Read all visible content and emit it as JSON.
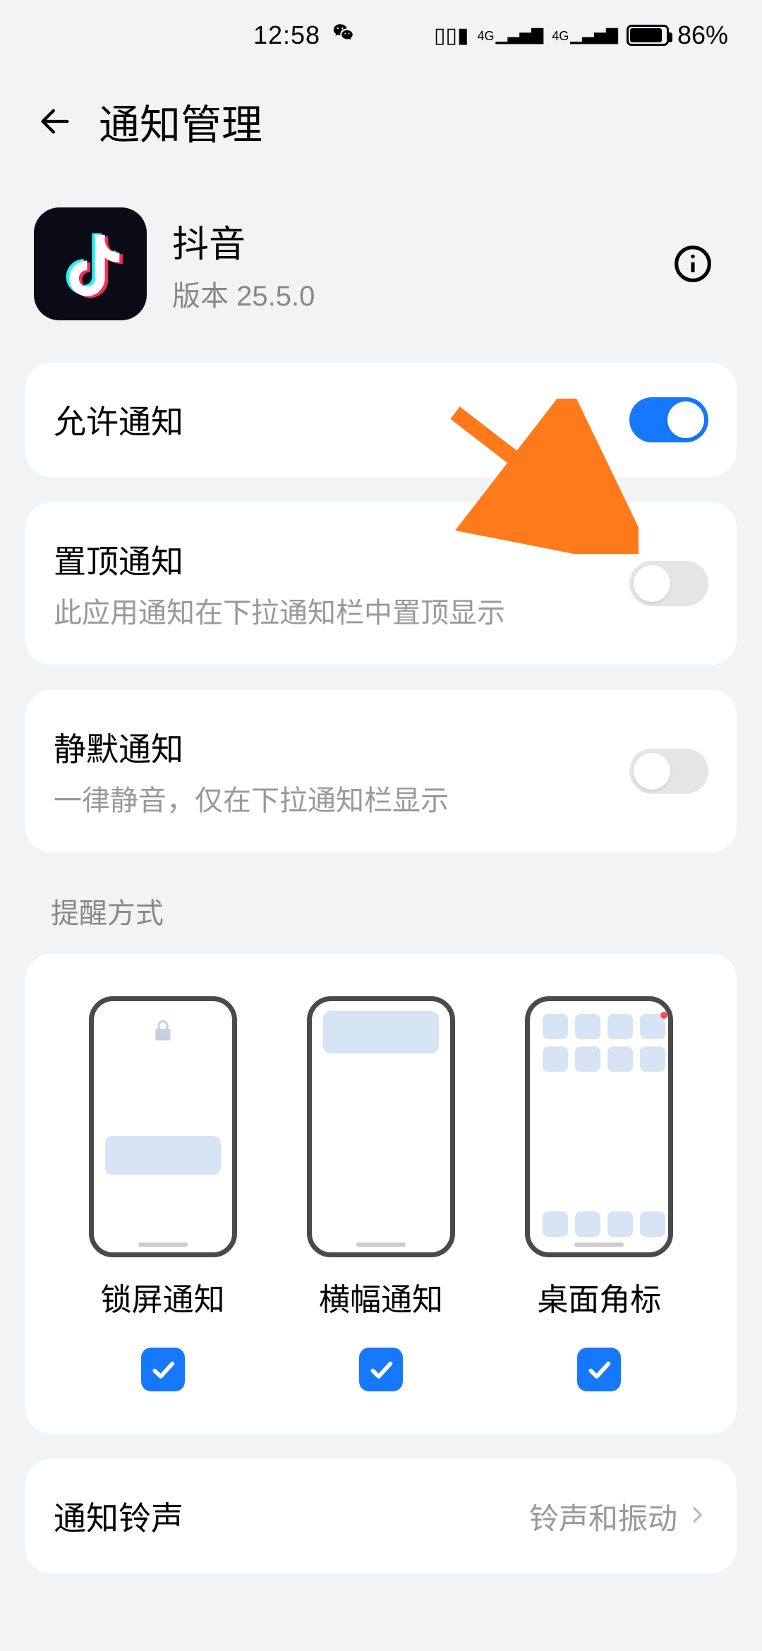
{
  "status": {
    "time": "12:58",
    "battery_pct": "86%"
  },
  "header": {
    "title": "通知管理"
  },
  "app": {
    "name": "抖音",
    "version": "版本 25.5.0"
  },
  "rows": {
    "allow": {
      "title": "允许通知",
      "on": true
    },
    "pin": {
      "title": "置顶通知",
      "sub": "此应用通知在下拉通知栏中置顶显示",
      "on": false
    },
    "silent": {
      "title": "静默通知",
      "sub": "一律静音，仅在下拉通知栏显示",
      "on": false
    }
  },
  "styles": {
    "section_label": "提醒方式",
    "lock": "锁屏通知",
    "banner": "横幅通知",
    "badge": "桌面角标"
  },
  "ringtone": {
    "title": "通知铃声",
    "value": "铃声和振动"
  }
}
